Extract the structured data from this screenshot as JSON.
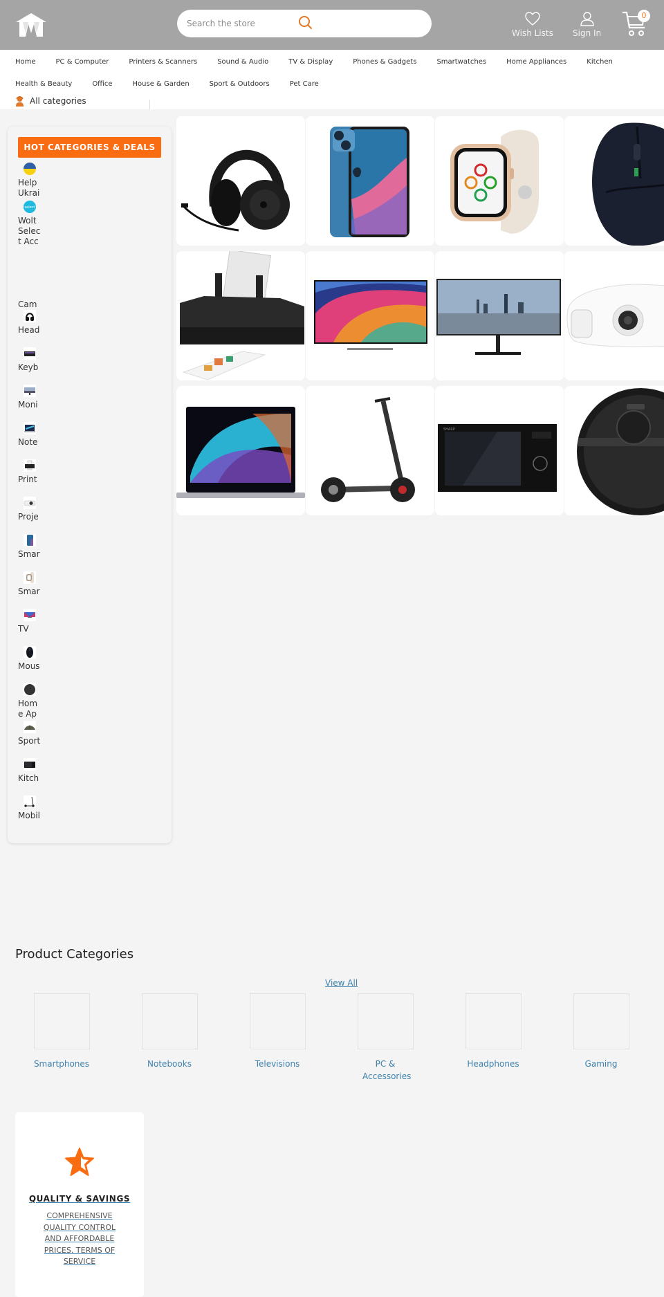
{
  "header": {
    "logo_alt": "W",
    "search_placeholder": "Search the store",
    "wish_lists_label": "Wish Lists",
    "sign_in_label": "Sign In",
    "cart_count": "0",
    "accent_color": "#f96c12"
  },
  "nav": {
    "row1": [
      "Home",
      "PC & Computer",
      "Printers & Scanners",
      "Sound & Audio",
      "TV & Display",
      "Phones & Gadgets",
      "Smartwatches",
      "Home Appliances",
      "Kitchen"
    ],
    "row2": [
      "Health & Beauty",
      "Office",
      "House & Garden",
      "Sport & Outdoors",
      "Pet Care"
    ],
    "all_categories_label": "All categories"
  },
  "sidebar": {
    "hot_button_label": "HOT CATEGORIES & DEALS",
    "items": [
      {
        "label": "Help Ukraine",
        "icon": "ukraine-flag-icon"
      },
      {
        "label": "Wolt Select Access",
        "icon": "wolt-icon"
      },
      {
        "label": "Cameras",
        "icon": "camera-icon"
      },
      {
        "label": "Headphones",
        "icon": "headphones-icon"
      },
      {
        "label": "Keyboards",
        "icon": "keyboard-icon"
      },
      {
        "label": "Monitors",
        "icon": "monitor-icon"
      },
      {
        "label": "Notebooks",
        "icon": "notebook-icon"
      },
      {
        "label": "Printers",
        "icon": "printer-icon"
      },
      {
        "label": "Projectors",
        "icon": "projector-icon"
      },
      {
        "label": "Smartphones",
        "icon": "smartphone-icon"
      },
      {
        "label": "Smartwatches",
        "icon": "smartwatch-icon"
      },
      {
        "label": "TV",
        "icon": "tv-icon"
      },
      {
        "label": "Mouse",
        "icon": "mouse-icon"
      },
      {
        "label": "Home Appliances",
        "icon": "robot-vacuum-icon"
      },
      {
        "label": "Sport",
        "icon": "tent-icon"
      },
      {
        "label": "Kitchen",
        "icon": "microwave-icon"
      },
      {
        "label": "Mobility",
        "icon": "scooter-icon"
      }
    ]
  },
  "products": [
    {
      "name": "Headphones",
      "icon": "headphones-image"
    },
    {
      "name": "Smartphone",
      "icon": "smartphone-image"
    },
    {
      "name": "Smartwatch",
      "icon": "smartwatch-image"
    },
    {
      "name": "Gaming Mouse",
      "icon": "mouse-image"
    },
    {
      "name": "Printer",
      "icon": "printer-image"
    },
    {
      "name": "TV",
      "icon": "tv-image"
    },
    {
      "name": "Monitor",
      "icon": "monitor-image"
    },
    {
      "name": "Projector",
      "icon": "projector-image"
    },
    {
      "name": "Notebook",
      "icon": "notebook-image"
    },
    {
      "name": "Electric Scooter",
      "icon": "scooter-image"
    },
    {
      "name": "Microwave",
      "icon": "microwave-image"
    },
    {
      "name": "Robot Vacuum",
      "icon": "robot-vacuum-image"
    }
  ],
  "product_categories": {
    "title": "Product Categories",
    "view_all_label": "View All",
    "items": [
      "Smartphones",
      "Notebooks",
      "Televisions",
      "PC & Accessories",
      "Headphones",
      "Gaming"
    ]
  },
  "quality": {
    "title": "QUALITY & SAVINGS",
    "description": "COMPREHENSIVE QUALITY CONTROL AND AFFORDABLE PRICES. TERMS OF SERVICE"
  }
}
